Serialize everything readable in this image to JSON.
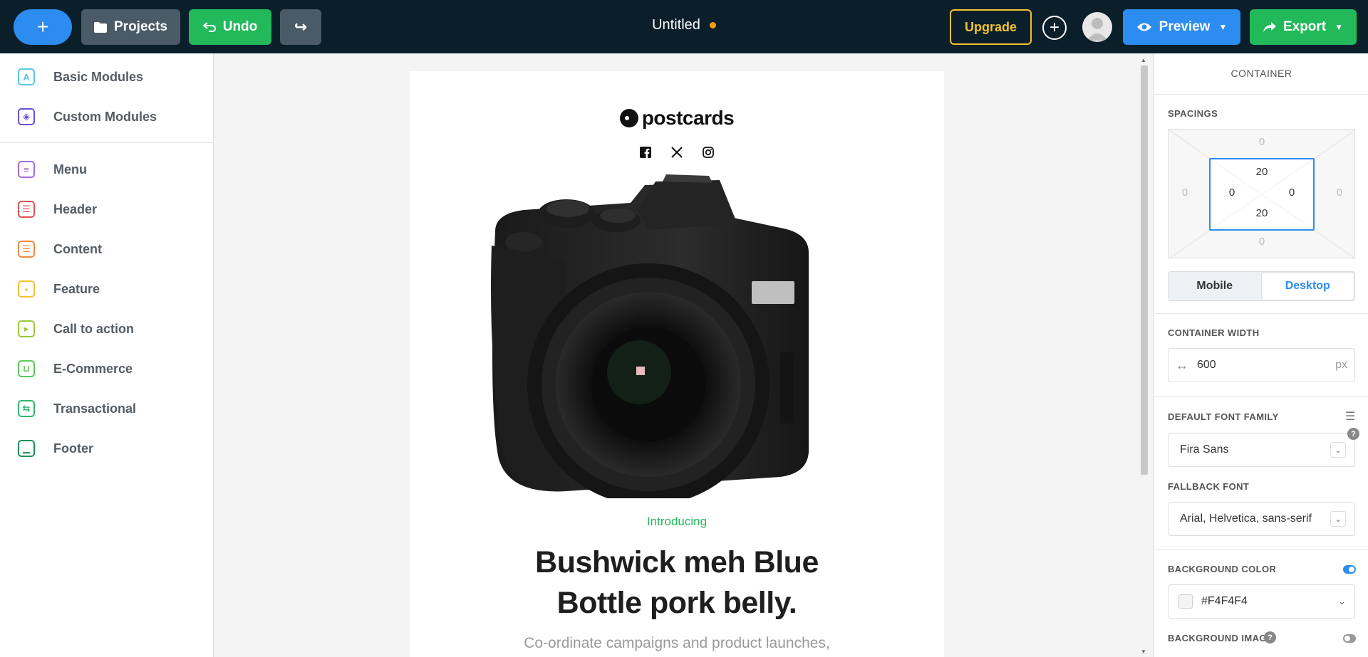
{
  "topbar": {
    "new_label": "+",
    "projects_label": "Projects",
    "undo_label": "Undo",
    "redo_label": "↪",
    "doc_title": "Untitled",
    "upgrade_label": "Upgrade",
    "add_label": "+",
    "preview_label": "Preview",
    "export_label": "Export"
  },
  "sidebar": {
    "items": [
      {
        "label": "Basic Modules",
        "icon": "letter-a-icon",
        "color": "#5bc8e8"
      },
      {
        "label": "Custom Modules",
        "icon": "puzzle-icon",
        "color": "#6a4fd8"
      },
      {
        "label": "Menu",
        "icon": "menu-module-icon",
        "color": "#a56ad8"
      },
      {
        "label": "Header",
        "icon": "header-module-icon",
        "color": "#e05050"
      },
      {
        "label": "Content",
        "icon": "content-module-icon",
        "color": "#f08a3e"
      },
      {
        "label": "Feature",
        "icon": "feature-module-icon",
        "color": "#f2c230"
      },
      {
        "label": "Call to action",
        "icon": "cta-module-icon",
        "color": "#9ac93a"
      },
      {
        "label": "E-Commerce",
        "icon": "cart-icon",
        "color": "#5cc95c"
      },
      {
        "label": "Transactional",
        "icon": "transactional-icon",
        "color": "#2eb86e"
      },
      {
        "label": "Footer",
        "icon": "footer-module-icon",
        "color": "#1f8f5a"
      }
    ]
  },
  "email": {
    "logo_text": "postcards",
    "intro": "Introducing",
    "headline": "Bushwick meh Blue Bottle pork belly.",
    "body": "Co-ordinate campaigns and product launches,"
  },
  "panel": {
    "title": "CONTAINER",
    "spacings_label": "SPACINGS",
    "spacing": {
      "outer_top": "0",
      "outer_right": "0",
      "outer_bottom": "0",
      "outer_left": "0",
      "inner_top": "20",
      "inner_right": "0",
      "inner_bottom": "20",
      "inner_left": "0"
    },
    "mobile_label": "Mobile",
    "desktop_label": "Desktop",
    "container_width_label": "CONTAINER WIDTH",
    "container_width": "600",
    "width_unit": "px",
    "default_font_label": "DEFAULT FONT FAMILY",
    "default_font": "Fira Sans",
    "fallback_font_label": "FALLBACK FONT",
    "fallback_font": "Arial, Helvetica, sans-serif",
    "bg_color_label": "BACKGROUND COLOR",
    "bg_color_value": "#F4F4F4",
    "bg_image_label": "BACKGROUND IMAGE"
  },
  "colors": {
    "topbar_bg": "#0b1f2a",
    "primary_blue": "#2d8cf0",
    "primary_green": "#22b95b",
    "upgrade_yellow": "#f1c232",
    "unsaved_dot": "#f59e0b"
  }
}
